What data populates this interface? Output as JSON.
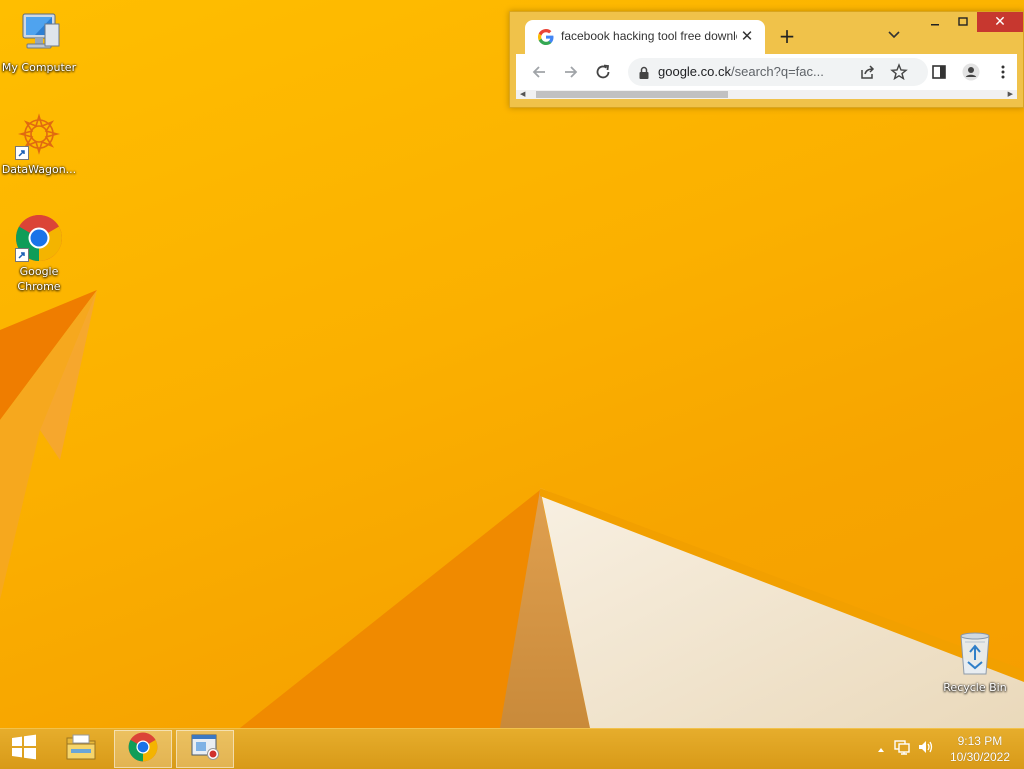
{
  "desktop": {
    "icons": [
      {
        "label": "My Computer"
      },
      {
        "label": "DataWagon..."
      },
      {
        "label": "Google Chrome"
      },
      {
        "label": "Recycle Bin"
      }
    ]
  },
  "browser": {
    "tab_title": "facebook hacking tool free download",
    "url_host": "google.co.ck",
    "url_rest": "/search?q=fac...",
    "icons": [
      "google-icon",
      "close-icon",
      "plus-icon",
      "chevron-down-icon",
      "back-arrow-icon",
      "forward-arrow-icon",
      "reload-icon",
      "lock-icon",
      "share-icon",
      "star-icon",
      "side-panel-icon",
      "profile-icon",
      "more-icon"
    ]
  },
  "taskbar": {
    "time": "9:13 PM",
    "date": "10/30/2022",
    "icons": [
      "windows-start-icon",
      "file-explorer-icon",
      "chrome-icon",
      "remote-app-icon",
      "tray-up-arrow-icon",
      "network-icon",
      "volume-icon"
    ]
  },
  "colors": {
    "wallpaper": "#ffbe00",
    "taskbar": "#e0a322",
    "close_button": "#c7372f"
  }
}
